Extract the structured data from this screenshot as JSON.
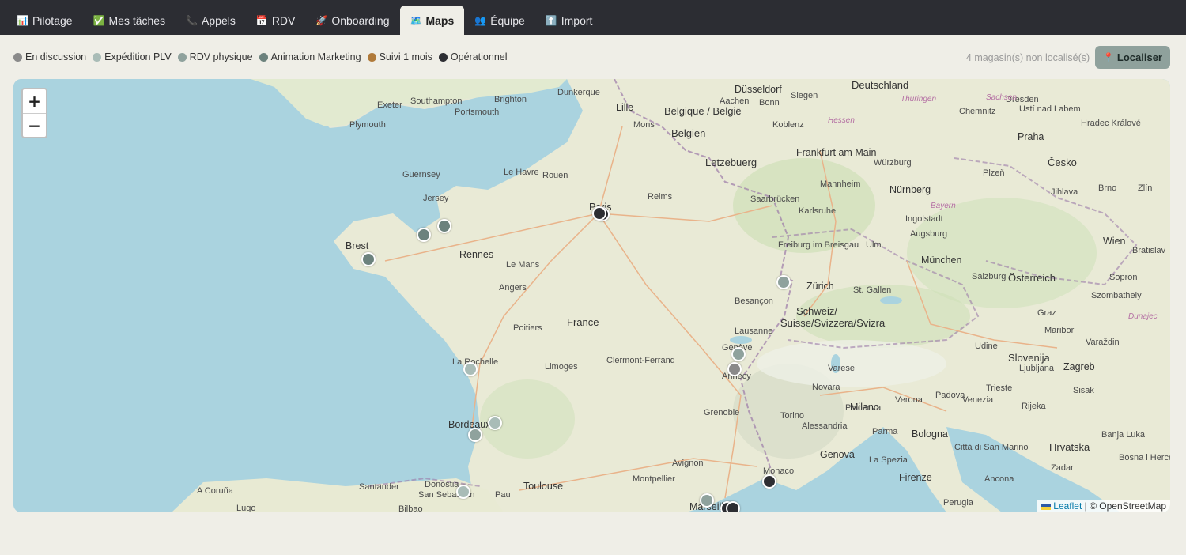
{
  "tabs": [
    {
      "icon": "📊",
      "icon_name": "chart-icon",
      "label": "Pilotage",
      "active": false
    },
    {
      "icon": "✅",
      "icon_name": "check-icon",
      "label": "Mes tâches",
      "active": false
    },
    {
      "icon": "📞",
      "icon_name": "phone-icon",
      "label": "Appels",
      "active": false
    },
    {
      "icon": "📅",
      "icon_name": "calendar-icon",
      "label": "RDV",
      "active": false
    },
    {
      "icon": "🚀",
      "icon_name": "rocket-icon",
      "label": "Onboarding",
      "active": false
    },
    {
      "icon": "🗺️",
      "icon_name": "map-icon",
      "label": "Maps",
      "active": true
    },
    {
      "icon": "👥",
      "icon_name": "team-icon",
      "label": "Équipe",
      "active": false
    },
    {
      "icon": "⬆️",
      "icon_name": "upload-icon",
      "label": "Import",
      "active": false
    }
  ],
  "legend": [
    {
      "label": "En discussion",
      "color": "#8a8a8a"
    },
    {
      "label": "Expédition PLV",
      "color": "#a9bcb7"
    },
    {
      "label": "RDV physique",
      "color": "#8fa29d"
    },
    {
      "label": "Animation Marketing",
      "color": "#6c827d"
    },
    {
      "label": "Suivi 1 mois",
      "color": "#b07a3a"
    },
    {
      "label": "Opérationnel",
      "color": "#2d2e33"
    }
  ],
  "unlocated_text": "4 magasin(s) non localisé(s)",
  "locate_button": {
    "icon": "📍",
    "label": "Localiser"
  },
  "zoom": {
    "in": "+",
    "out": "−"
  },
  "attribution": {
    "leaflet": "Leaflet",
    "separator": "|",
    "osm": "© OpenStreetMap"
  },
  "map_labels": {
    "cities": [
      "Exeter",
      "Southampton",
      "Brighton",
      "Portsmouth",
      "Plymouth",
      "Dunkerque",
      "Lille",
      "Düsseldorf",
      "Aachen",
      "Bonn",
      "Siegen",
      "Koblenz",
      "Mons",
      "Guernsey",
      "Jersey",
      "Le Havre",
      "Rouen",
      "Paris",
      "Reims",
      "Letzebuerg",
      "Frankfurt am Main",
      "Würzburg",
      "Mannheim",
      "Saarbrücken",
      "Nürnberg",
      "Karlsruhe",
      "Brest",
      "Rennes",
      "Le Mans",
      "Angers",
      "Ingolstadt",
      "Augsburg",
      "Freiburg im Breisgau",
      "Ulm",
      "München",
      "Zürich",
      "Besançon",
      "Salzburg",
      "St. Gallen",
      "Poitiers",
      "La Rochelle",
      "Limoges",
      "Clermont-Ferrand",
      "Lausanne",
      "Genève",
      "Annecy",
      "Bordeaux",
      "Grenoble",
      "Toulouse",
      "Montpellier",
      "Marseille",
      "Avignon",
      "Monaco",
      "Genova",
      "Torino",
      "Milano",
      "Varese",
      "Novara",
      "Verona",
      "Padova",
      "Venezia",
      "Trieste",
      "Udine",
      "Zagreb",
      "Ljubljana",
      "Bologna",
      "Parma",
      "Piacenza",
      "Alessandria",
      "La Spezia",
      "Firenze",
      "Perugia",
      "Ancona",
      "Città di San Marino",
      "Rijeka",
      "Sisak",
      "Zadar",
      "Bosna i Herce",
      "Banja Luka",
      "Maribor",
      "Graz",
      "Varaždin",
      "Wien",
      "Bratislav",
      "Brno",
      "Praha",
      "Chemnitz",
      "Dresden",
      "Plzeň",
      "Jihlava",
      "Zlín",
      "Hradec Králové",
      "Ústí nad Labem",
      "Sopron",
      "Szombathely",
      "Donostia",
      "San Sebastián",
      "Bilbao",
      "Santander",
      "A Coruña",
      "Lugo",
      "Pau",
      "Dunajec",
      "Bayern",
      "Hessen",
      "Sachsen",
      "Thüringen",
      "Deutschland",
      "Česko",
      "Österreich",
      "Slovenija",
      "Hrvatska",
      "Suisse/Svizzera/Svizra",
      "Schweiz/",
      "France",
      "Belgique / België",
      "Belgien"
    ]
  },
  "markers": [
    {
      "status": "Opérationnel",
      "city": "Paris"
    },
    {
      "status": "Opérationnel",
      "city": "Paris"
    },
    {
      "status": "Animation Marketing",
      "city": "Saint-Malo"
    },
    {
      "status": "Animation Marketing",
      "city": "Saint-Brieuc"
    },
    {
      "status": "Animation Marketing",
      "city": "Brest"
    },
    {
      "status": "RDV physique",
      "city": "Basel"
    },
    {
      "status": "RDV physique",
      "city": "Genève"
    },
    {
      "status": "En discussion",
      "city": "Annecy"
    },
    {
      "status": "Expédition PLV",
      "city": "La Rochelle"
    },
    {
      "status": "Expédition PLV",
      "city": "Bordeaux"
    },
    {
      "status": "RDV physique",
      "city": "Bordeaux"
    },
    {
      "status": "Expédition PLV",
      "city": "Bayonne"
    },
    {
      "status": "RDV physique",
      "city": "Marseille"
    },
    {
      "status": "Opérationnel",
      "city": "Marseille"
    },
    {
      "status": "Opérationnel",
      "city": "Marseille"
    },
    {
      "status": "Opérationnel",
      "city": "Nice"
    }
  ]
}
